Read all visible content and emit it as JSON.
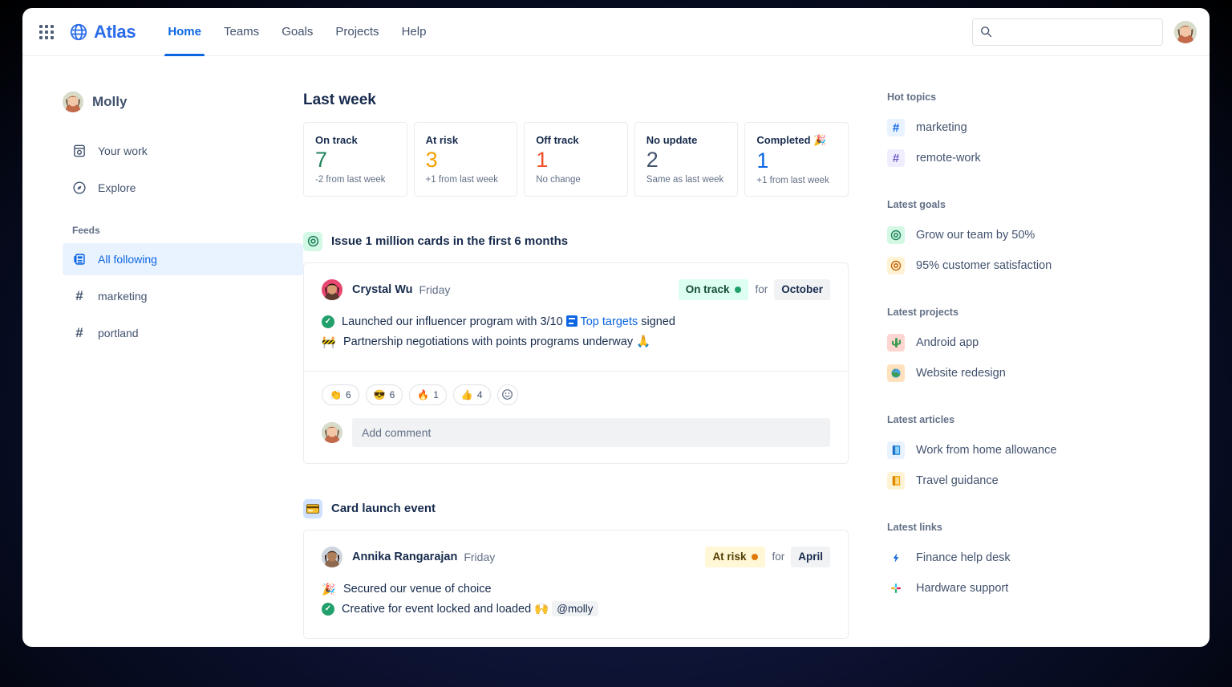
{
  "nav": {
    "app_switcher": "app-switcher",
    "brand": "Atlas",
    "links": [
      {
        "label": "Home",
        "active": true
      },
      {
        "label": "Teams",
        "active": false
      },
      {
        "label": "Goals",
        "active": false
      },
      {
        "label": "Projects",
        "active": false
      },
      {
        "label": "Help",
        "active": false
      }
    ],
    "search_placeholder": "",
    "search_value": ""
  },
  "sidebar": {
    "user": "Molly",
    "items": [
      {
        "label": "Your work",
        "icon": "your-work-icon"
      },
      {
        "label": "Explore",
        "icon": "compass-icon"
      }
    ],
    "feeds_header": "Feeds",
    "feeds": [
      {
        "label": "All following",
        "icon": "feed-icon",
        "selected": true
      },
      {
        "label": "marketing",
        "icon": "hash-icon",
        "selected": false
      },
      {
        "label": "portland",
        "icon": "hash-icon",
        "selected": false
      }
    ]
  },
  "main": {
    "title": "Last week",
    "stats": [
      {
        "label": "On track",
        "value": "7",
        "color": "#1f845a",
        "sub": "-2 from last week"
      },
      {
        "label": "At risk",
        "value": "3",
        "color": "#f59f00",
        "sub": "+1 from last week"
      },
      {
        "label": "Off track",
        "value": "1",
        "color": "#f4512c",
        "sub": "No change"
      },
      {
        "label": "No update",
        "value": "2",
        "color": "#44546f",
        "sub": "Same as last week"
      },
      {
        "label": "Completed 🎉",
        "value": "1",
        "color": "#0c66e4",
        "sub": "+1 from last week"
      }
    ],
    "feed": [
      {
        "icon": "goal-target-icon",
        "icon_glyph": "◎",
        "icon_bg": "#d3f8e4",
        "icon_color": "#1f845a",
        "title": "Issue 1 million cards in the first 6 months",
        "author": "Crystal Wu",
        "when": "Friday",
        "status": "On track",
        "status_type": "ontrack",
        "status_dot": "#22a06b",
        "for_word": "for",
        "period": "October",
        "bullets": [
          {
            "marker": "check",
            "glyph": "",
            "pre": "Launched our influencer program with 3/10 ",
            "doc_chip": true,
            "link": "Top targets",
            "post": " signed"
          },
          {
            "marker": "glyph",
            "glyph": "🚧",
            "pre": "Partnership negotiations with points programs underway 🙏",
            "doc_chip": false,
            "link": "",
            "post": ""
          }
        ],
        "reactions": [
          {
            "emoji": "👏",
            "count": "6"
          },
          {
            "emoji": "😎",
            "count": "6"
          },
          {
            "emoji": "🔥",
            "count": "1"
          },
          {
            "emoji": "👍",
            "count": "4"
          }
        ],
        "add_reaction_icon": "add-reaction-icon",
        "comment_placeholder": "Add comment",
        "has_footer": true
      },
      {
        "icon": "credit-card-icon",
        "icon_glyph": "💳",
        "icon_bg": "#cfe1fd",
        "icon_color": "#0c66e4",
        "title": "Card launch event",
        "author": "Annika Rangarajan",
        "when": "Friday",
        "status": "At risk",
        "status_type": "atrisk",
        "status_dot": "#e2790b",
        "for_word": "for",
        "period": "April",
        "bullets": [
          {
            "marker": "glyph",
            "glyph": "🎉",
            "pre": "Secured our venue of choice",
            "doc_chip": false,
            "link": "",
            "post": ""
          },
          {
            "marker": "check",
            "glyph": "",
            "pre": "Creative for event locked and loaded 🙌 ",
            "doc_chip": false,
            "link": "",
            "post": "",
            "mention": "@molly"
          }
        ],
        "reactions": [],
        "add_reaction_icon": "",
        "comment_placeholder": "",
        "has_footer": false
      }
    ]
  },
  "rightbar": {
    "groups": [
      {
        "header": "Hot topics",
        "items": [
          {
            "label": "marketing",
            "icon": "hash-icon",
            "glyph": "#",
            "bg": "#e9f2ff",
            "color": "#0c66e4"
          },
          {
            "label": "remote-work",
            "icon": "hash-icon",
            "glyph": "#",
            "bg": "#f0edff",
            "color": "#6e5dc6"
          }
        ]
      },
      {
        "header": "Latest goals",
        "items": [
          {
            "label": "Grow our team by 50%",
            "icon": "goal-target-icon",
            "glyph": "◎",
            "bg": "#d3f8e4",
            "color": "#1f845a"
          },
          {
            "label": "95% customer satisfaction",
            "icon": "goal-target-icon",
            "glyph": "◎",
            "bg": "#fff3d6",
            "color": "#c9680a"
          }
        ]
      },
      {
        "header": "Latest projects",
        "items": [
          {
            "label": "Android app",
            "icon": "cactus-icon",
            "glyph": "🌵",
            "bg": "#ffd5d2",
            "color": "#ae2e24"
          },
          {
            "label": "Website redesign",
            "icon": "globe-icon",
            "glyph": "🌍",
            "bg": "#ffe2bd",
            "color": "#a54800"
          }
        ]
      },
      {
        "header": "Latest articles",
        "items": [
          {
            "label": "Work from home allowance",
            "icon": "book-icon",
            "glyph": "📘",
            "bg": "#e9f2ff",
            "color": "#0c66e4"
          },
          {
            "label": "Travel guidance",
            "icon": "book-icon",
            "glyph": "📙",
            "bg": "#fff3d6",
            "color": "#c9680a"
          }
        ]
      },
      {
        "header": "Latest links",
        "items": [
          {
            "label": "Finance help desk",
            "icon": "lightning-icon",
            "glyph": "⚡",
            "bg": "#ffffff",
            "color": "#0c66e4"
          },
          {
            "label": "Hardware support",
            "icon": "slack-icon",
            "glyph": "✳",
            "bg": "#ffffff",
            "color": "#e01e5a"
          }
        ]
      }
    ]
  }
}
